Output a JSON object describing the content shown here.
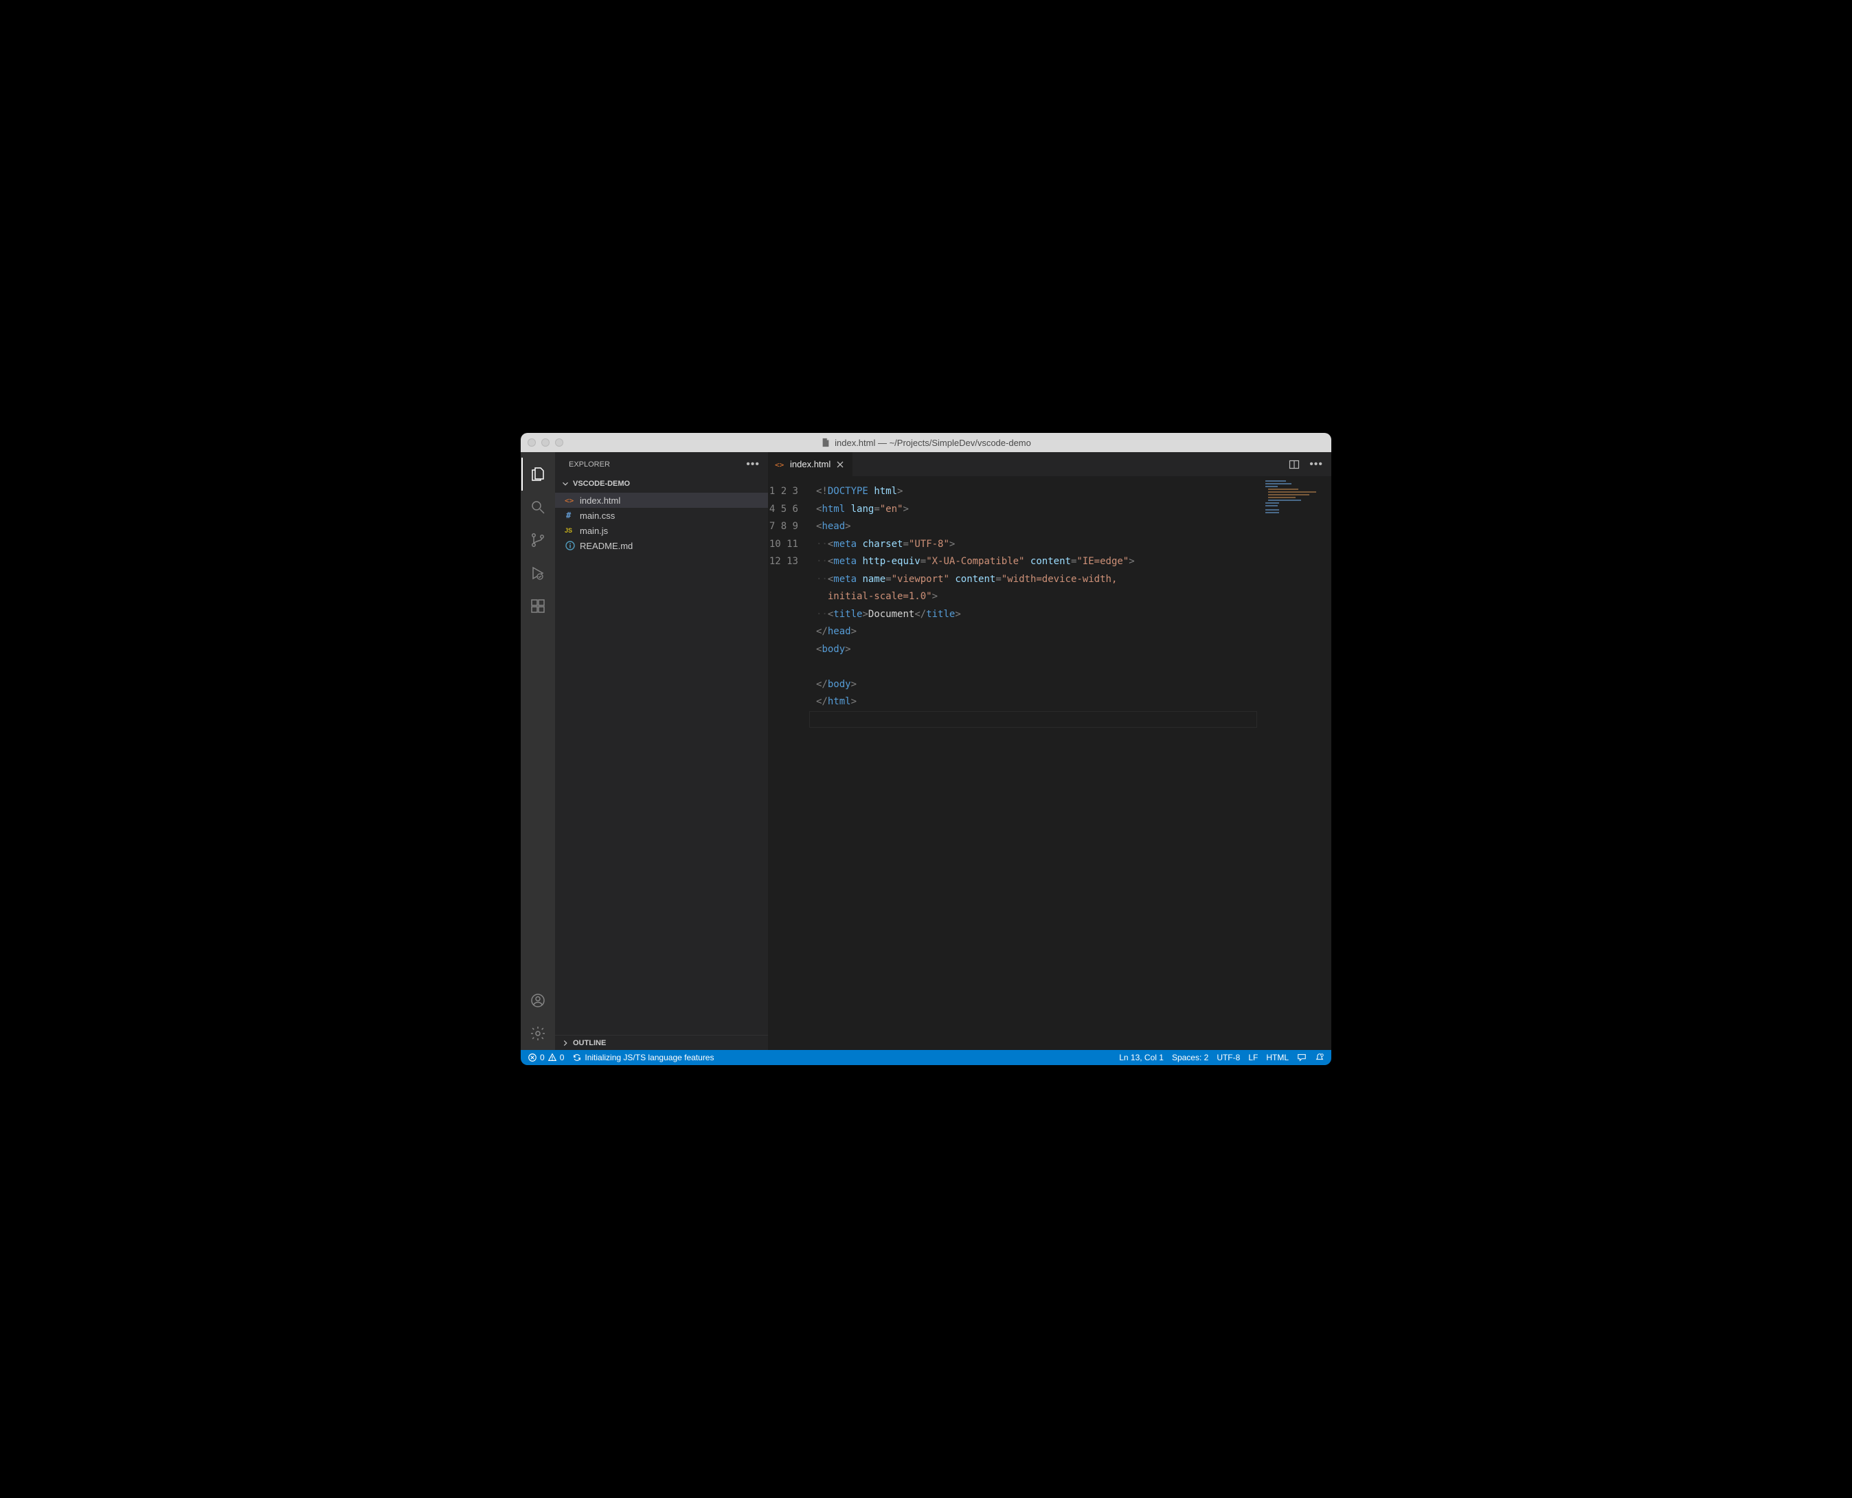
{
  "window": {
    "title": "index.html — ~/Projects/SimpleDev/vscode-demo"
  },
  "activitybar": {
    "items": [
      "explorer",
      "search",
      "source-control",
      "run",
      "extensions"
    ],
    "bottom": [
      "accounts",
      "settings"
    ]
  },
  "sidebar": {
    "title": "EXPLORER",
    "folder": "VSCODE-DEMO",
    "files": [
      {
        "name": "index.html",
        "kind": "html",
        "active": true
      },
      {
        "name": "main.css",
        "kind": "css",
        "active": false
      },
      {
        "name": "main.js",
        "kind": "js",
        "active": false
      },
      {
        "name": "README.md",
        "kind": "md",
        "active": false
      }
    ],
    "outline": "OUTLINE"
  },
  "editor": {
    "tab": {
      "name": "index.html"
    },
    "current_line": 13,
    "lines": [
      [
        {
          "t": "br",
          "v": "<!"
        },
        {
          "t": "tag",
          "v": "DOCTYPE"
        },
        {
          "t": "txt",
          "v": " "
        },
        {
          "t": "attr",
          "v": "html"
        },
        {
          "t": "br",
          "v": ">"
        }
      ],
      [
        {
          "t": "br",
          "v": "<"
        },
        {
          "t": "tag",
          "v": "html"
        },
        {
          "t": "txt",
          "v": " "
        },
        {
          "t": "attr",
          "v": "lang"
        },
        {
          "t": "br",
          "v": "="
        },
        {
          "t": "str",
          "v": "\"en\""
        },
        {
          "t": "br",
          "v": ">"
        }
      ],
      [
        {
          "t": "br",
          "v": "<"
        },
        {
          "t": "tag",
          "v": "head"
        },
        {
          "t": "br",
          "v": ">"
        }
      ],
      [
        {
          "t": "ws",
          "v": "··"
        },
        {
          "t": "br",
          "v": "<"
        },
        {
          "t": "tag",
          "v": "meta"
        },
        {
          "t": "txt",
          "v": " "
        },
        {
          "t": "attr",
          "v": "charset"
        },
        {
          "t": "br",
          "v": "="
        },
        {
          "t": "str",
          "v": "\"UTF-8\""
        },
        {
          "t": "br",
          "v": ">"
        }
      ],
      [
        {
          "t": "ws",
          "v": "··"
        },
        {
          "t": "br",
          "v": "<"
        },
        {
          "t": "tag",
          "v": "meta"
        },
        {
          "t": "txt",
          "v": " "
        },
        {
          "t": "attr",
          "v": "http-equiv"
        },
        {
          "t": "br",
          "v": "="
        },
        {
          "t": "str",
          "v": "\"X-UA-Compatible\""
        },
        {
          "t": "txt",
          "v": " "
        },
        {
          "t": "attr",
          "v": "content"
        },
        {
          "t": "br",
          "v": "="
        },
        {
          "t": "str",
          "v": "\"IE=edge\""
        },
        {
          "t": "br",
          "v": ">"
        }
      ],
      [
        {
          "t": "ws",
          "v": "··"
        },
        {
          "t": "br",
          "v": "<"
        },
        {
          "t": "tag",
          "v": "meta"
        },
        {
          "t": "txt",
          "v": " "
        },
        {
          "t": "attr",
          "v": "name"
        },
        {
          "t": "br",
          "v": "="
        },
        {
          "t": "str",
          "v": "\"viewport\""
        },
        {
          "t": "txt",
          "v": " "
        },
        {
          "t": "attr",
          "v": "content"
        },
        {
          "t": "br",
          "v": "="
        },
        {
          "t": "str",
          "v": "\"width=device-width,\n  initial-scale=1.0\""
        },
        {
          "t": "br",
          "v": ">"
        }
      ],
      [
        {
          "t": "ws",
          "v": "··"
        },
        {
          "t": "br",
          "v": "<"
        },
        {
          "t": "tag",
          "v": "title"
        },
        {
          "t": "br",
          "v": ">"
        },
        {
          "t": "txt",
          "v": "Document"
        },
        {
          "t": "br",
          "v": "</"
        },
        {
          "t": "tag",
          "v": "title"
        },
        {
          "t": "br",
          "v": ">"
        }
      ],
      [
        {
          "t": "br",
          "v": "</"
        },
        {
          "t": "tag",
          "v": "head"
        },
        {
          "t": "br",
          "v": ">"
        }
      ],
      [
        {
          "t": "br",
          "v": "<"
        },
        {
          "t": "tag",
          "v": "body"
        },
        {
          "t": "br",
          "v": ">"
        }
      ],
      [],
      [
        {
          "t": "br",
          "v": "</"
        },
        {
          "t": "tag",
          "v": "body"
        },
        {
          "t": "br",
          "v": ">"
        }
      ],
      [
        {
          "t": "br",
          "v": "</"
        },
        {
          "t": "tag",
          "v": "html"
        },
        {
          "t": "br",
          "v": ">"
        }
      ],
      []
    ]
  },
  "statusbar": {
    "errors": "0",
    "warnings": "0",
    "sync_text": "Initializing JS/TS language features",
    "cursor": "Ln 13, Col 1",
    "spaces": "Spaces: 2",
    "encoding": "UTF-8",
    "eol": "LF",
    "language": "HTML"
  },
  "icon_colors": {
    "html": "#e37933",
    "css": "#6299d0",
    "js": "#cbb41b",
    "md": "#519aba"
  }
}
